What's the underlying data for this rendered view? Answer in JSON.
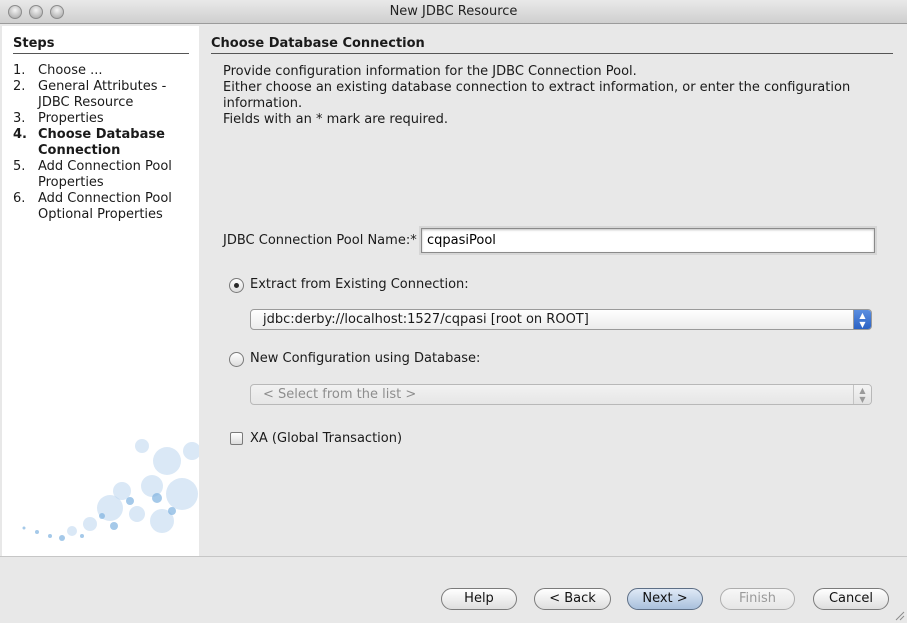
{
  "window": {
    "title": "New JDBC Resource"
  },
  "steps": {
    "header": "Steps",
    "items": [
      {
        "num": "1.",
        "label": "Choose ..."
      },
      {
        "num": "2.",
        "label": "General Attributes - JDBC Resource"
      },
      {
        "num": "3.",
        "label": "Properties"
      },
      {
        "num": "4.",
        "label": "Choose Database Connection"
      },
      {
        "num": "5.",
        "label": "Add Connection Pool Properties"
      },
      {
        "num": "6.",
        "label": "Add Connection Pool Optional Properties"
      }
    ]
  },
  "content": {
    "header": "Choose Database Connection",
    "desc_line1": "Provide configuration information for the JDBC Connection Pool.",
    "desc_line2": "Either choose an existing database connection to extract information, or enter the configuration information.",
    "desc_line3": "Fields with an * mark are required.",
    "pool_name_label": "JDBC Connection Pool Name:*",
    "pool_name_value": "cqpasiPool",
    "extract_label": "Extract from Existing Connection:",
    "extract_selected": "jdbc:derby://localhost:1527/cqpasi [root on ROOT]",
    "newconfig_label": "New Configuration using Database:",
    "newconfig_selected": "< Select from the list >",
    "xa_label": "XA (Global Transaction)"
  },
  "buttons": {
    "help": "Help",
    "back": "< Back",
    "next": "Next >",
    "finish": "Finish",
    "cancel": "Cancel"
  }
}
